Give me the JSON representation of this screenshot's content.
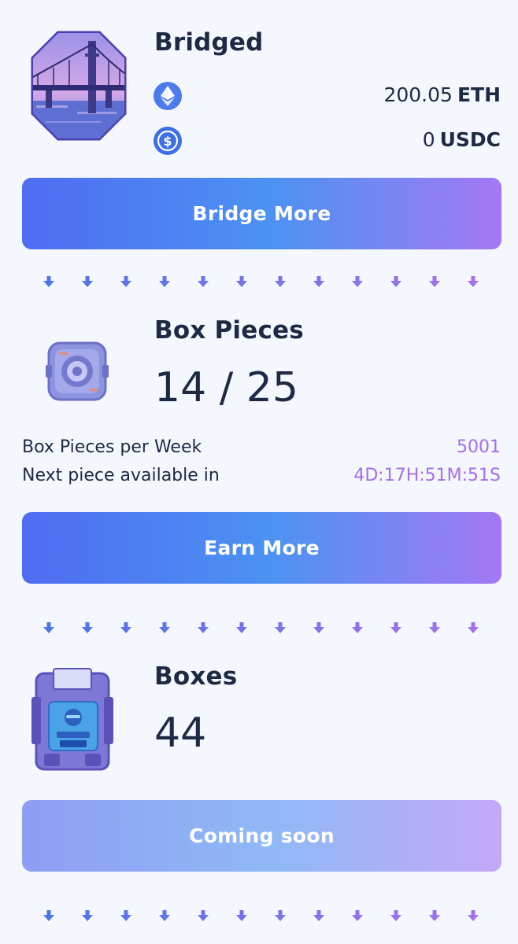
{
  "bridged": {
    "title": "Bridged",
    "eth": {
      "value": "200.05",
      "unit": "ETH",
      "icon": "ethereum-icon"
    },
    "usdc": {
      "value": "0",
      "unit": "USDC",
      "icon": "usdc-icon"
    },
    "button_label": "Bridge More"
  },
  "box_pieces": {
    "title": "Box Pieces",
    "count": "14 / 25",
    "per_week_label": "Box Pieces per Week",
    "per_week_value": "5001",
    "next_label": "Next piece available in",
    "next_value": "4D:17H:51M:51S",
    "button_label": "Earn More"
  },
  "boxes": {
    "title": "Boxes",
    "count": "44",
    "button_label": "Coming soon"
  },
  "colors": {
    "page_bg": "#f4f7fd",
    "text": "#1e2a44",
    "accent_purple": "#a56fe8",
    "gradient_start": "#4f6cf2",
    "gradient_mid": "#4c92f2",
    "gradient_end": "#a478f4"
  }
}
